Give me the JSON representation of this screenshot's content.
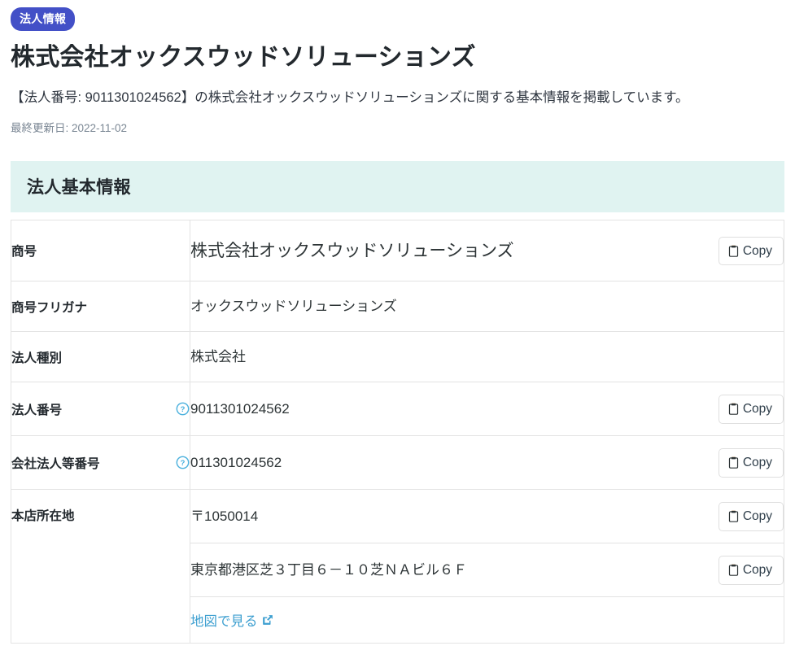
{
  "header": {
    "badge_label": "法人情報",
    "title": "株式会社オックスウッドソリューションズ",
    "lead": "【法人番号: 9011301024562】の株式会社オックスウッドソリューションズに関する基本情報を掲載しています。",
    "updated": "最終更新日: 2022-11-02"
  },
  "card": {
    "section_title": "法人基本情報"
  },
  "labels": {
    "trade_name": "商号",
    "trade_name_kana": "商号フリガナ",
    "corporate_type": "法人種別",
    "corporate_number": "法人番号",
    "company_number": "会社法人等番号",
    "head_office": "本店所在地"
  },
  "values": {
    "trade_name": "株式会社オックスウッドソリューションズ",
    "trade_name_kana": "オックスウッドソリューションズ",
    "corporate_type": "株式会社",
    "corporate_number": "9011301024562",
    "company_number": "011301024562",
    "postal_code": "〒1050014",
    "address": "東京都港区芝３丁目６－１０芝ＮＡビル６Ｆ",
    "map_link_label": "地図で見る"
  },
  "buttons": {
    "copy_label": "Copy"
  },
  "icons": {
    "help": "question-circle-icon",
    "clipboard": "clipboard-icon",
    "external_link": "external-link-icon"
  },
  "colors": {
    "badge_bg": "#4350c7",
    "section_header_bg": "#e0f3f1",
    "link": "#3d9fd0",
    "help_icon": "#4ab0dd",
    "border": "#e3e3e3",
    "muted_text": "#7b8794"
  }
}
